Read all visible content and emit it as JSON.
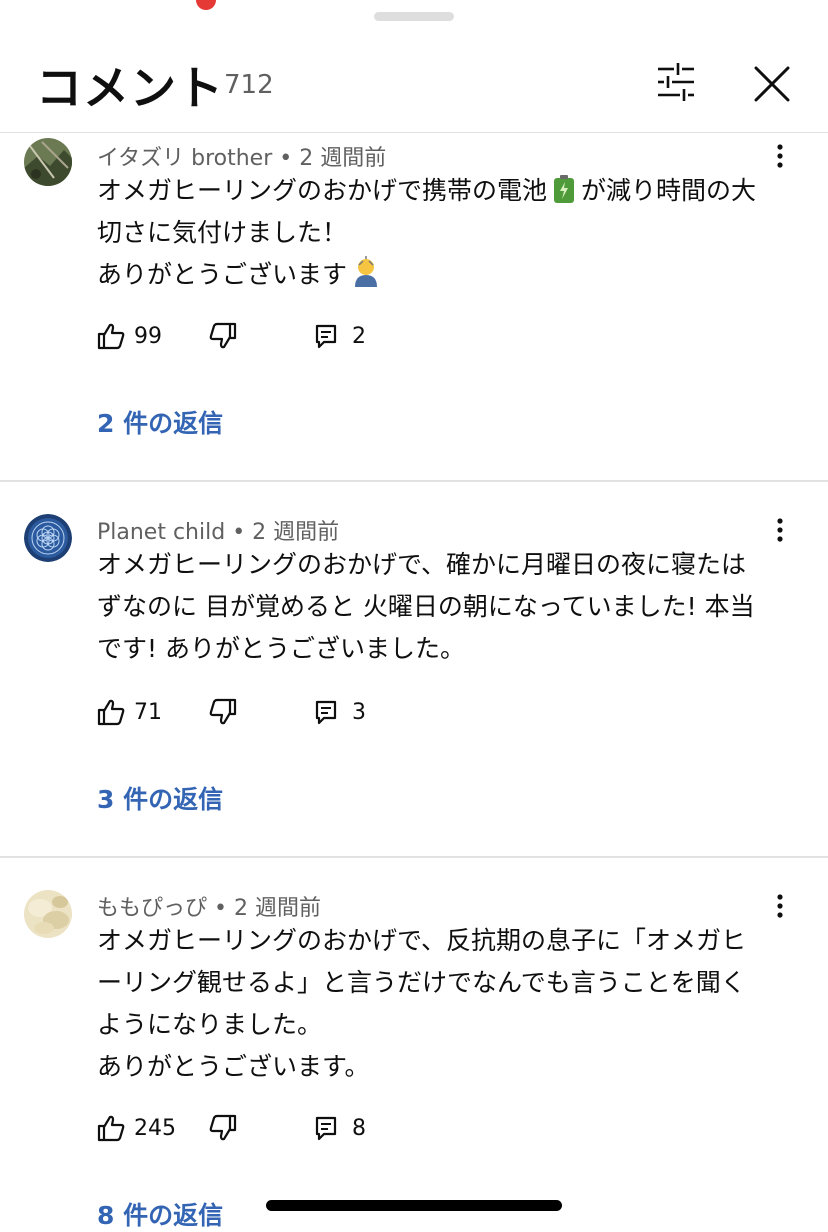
{
  "header": {
    "title": "コメント",
    "count": "712"
  },
  "icons": {
    "filter": "sliders-icon",
    "close": "close-icon",
    "more": "more-vertical-icon",
    "like": "thumbs-up-icon",
    "dislike": "thumbs-down-icon",
    "reply": "reply-icon"
  },
  "colors": {
    "link": "#3465b4",
    "meta": "#606060",
    "divider": "#e2e2e2"
  },
  "comments": [
    {
      "author": "イタズリ brother",
      "time": "2 週間前",
      "body_lines": [
        "オメガヒーリングのおかげで携帯の電池",
        "が減り時間の大",
        "切さに気付けました！",
        "ありがとうございます"
      ],
      "likes": "99",
      "replies_count": "2",
      "replies_link": "2 件の返信"
    },
    {
      "author": "Planet child",
      "time": "2 週間前",
      "body": "オメガヒーリングのおかげで、確かに月曜日の夜に寝たは\nずなのに 目が覚めると 火曜日の朝になっていました! 本当\nです! ありがとうございました。",
      "likes": "71",
      "replies_count": "3",
      "replies_link": "3 件の返信"
    },
    {
      "author": "ももぴっぴ",
      "time": "2 週間前",
      "body": "オメガヒーリングのおかげで、反抗期の息子に「オメガヒ\nーリング観せるよ」と言うだけでなんでも言うことを聞く\nようになりました。\nありがとうございます。",
      "likes": "245",
      "replies_count": "8",
      "replies_link": "8 件の返信"
    }
  ]
}
